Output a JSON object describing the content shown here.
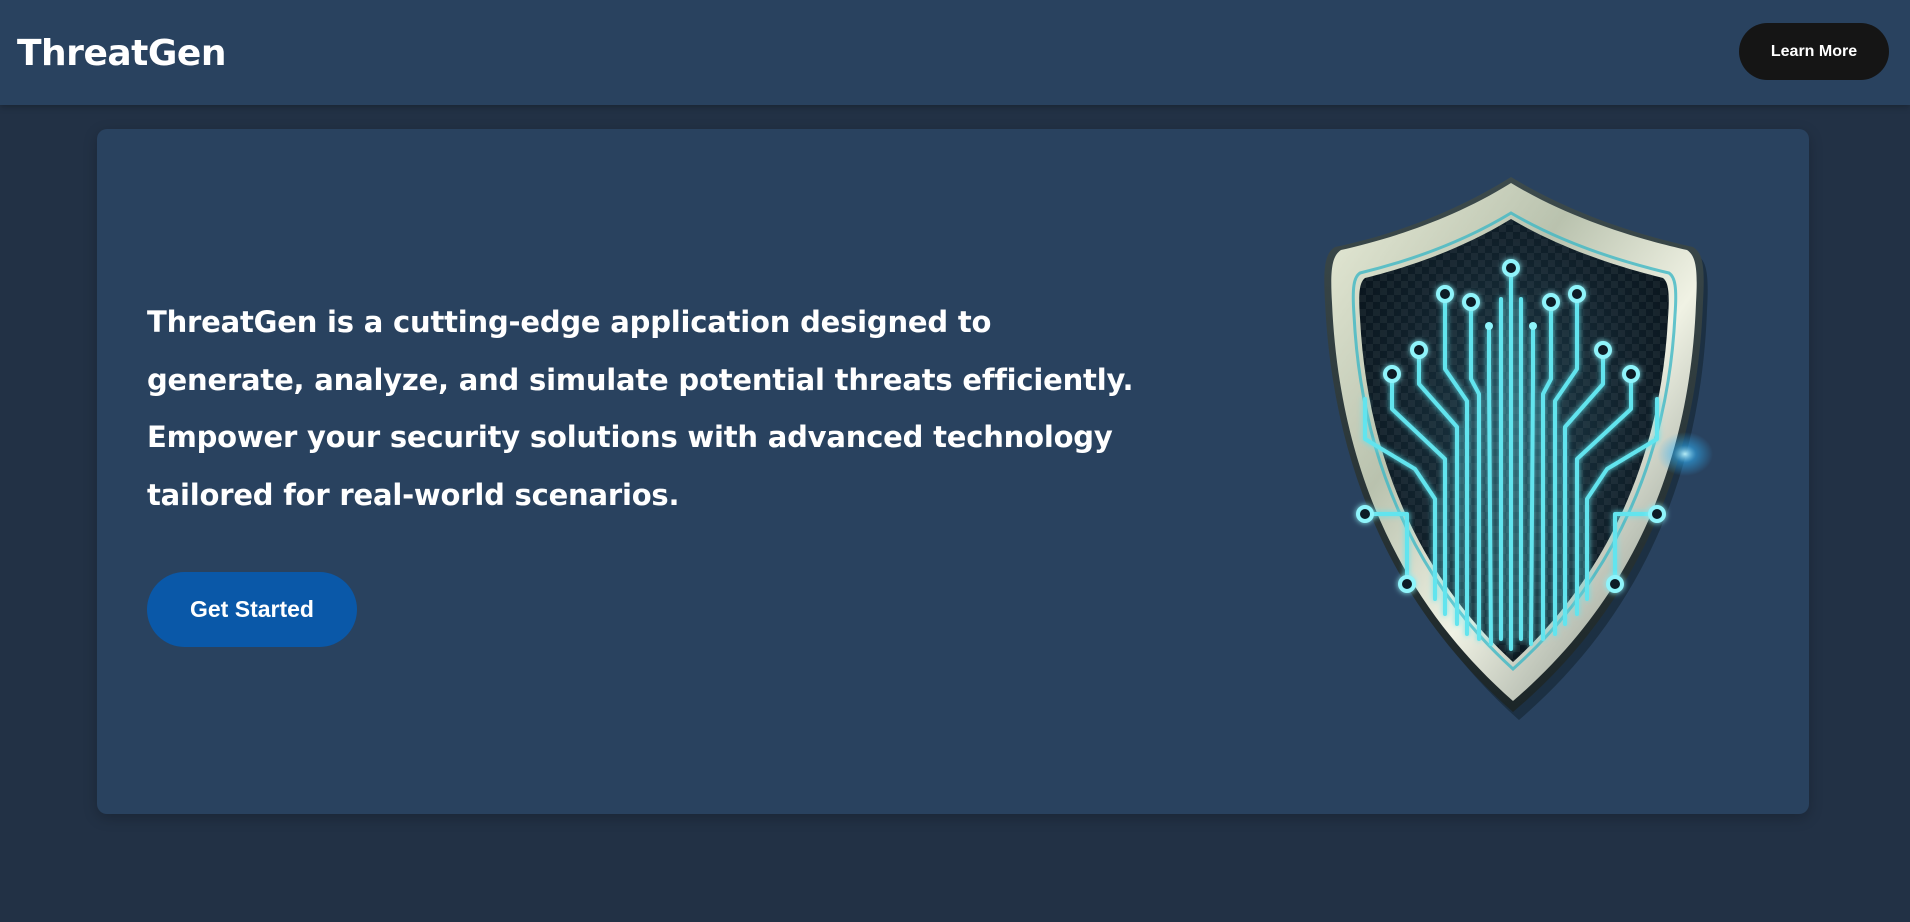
{
  "header": {
    "brand": "ThreatGen",
    "learn_more_label": "Learn More"
  },
  "hero": {
    "description": "ThreatGen is a cutting-edge application designed to generate, analyze, and simulate potential threats efficiently. Empower your security solutions with advanced technology tailored for real-world scenarios.",
    "cta_label": "Get Started",
    "image_icon": "shield-circuit-icon"
  },
  "colors": {
    "page_bg": "#223145",
    "panel_bg": "#29425f",
    "cta_bg": "#0a58a8",
    "learn_more_bg": "#151515",
    "circuit_glow": "#5ee6f0"
  }
}
